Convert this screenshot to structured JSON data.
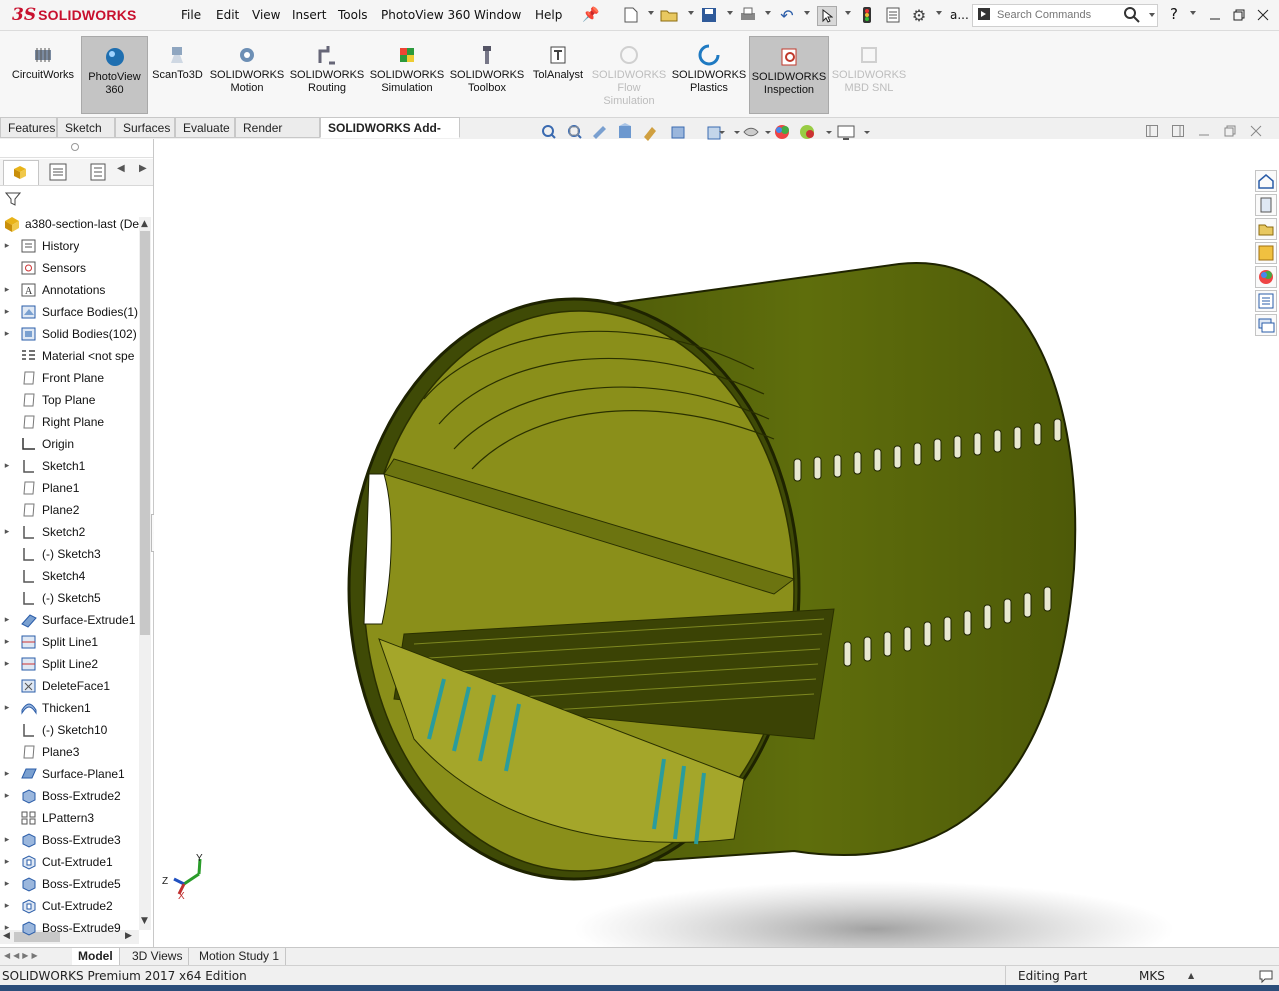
{
  "app": {
    "logo_ds": "3S",
    "logo_text": "SOLIDWORKS"
  },
  "menu": [
    "File",
    "Edit",
    "View",
    "Insert",
    "Tools",
    "PhotoView 360",
    "Window",
    "Help"
  ],
  "quick_access": {
    "overflow": "a...",
    "search_placeholder": "Search Commands",
    "help": "?"
  },
  "command_manager": [
    {
      "label": "CircuitWorks",
      "state": "normal"
    },
    {
      "label": "PhotoView\n360",
      "state": "active"
    },
    {
      "label": "ScanTo3D",
      "state": "normal"
    },
    {
      "label": "SOLIDWORKS\nMotion",
      "state": "normal"
    },
    {
      "label": "SOLIDWORKS\nRouting",
      "state": "normal"
    },
    {
      "label": "SOLIDWORKS\nSimulation",
      "state": "normal"
    },
    {
      "label": "SOLIDWORKS\nToolbox",
      "state": "normal"
    },
    {
      "label": "TolAnalyst",
      "state": "normal"
    },
    {
      "label": "SOLIDWORKS\nFlow\nSimulation",
      "state": "disabled"
    },
    {
      "label": "SOLIDWORKS\nPlastics",
      "state": "normal"
    },
    {
      "label": "SOLIDWORKS\nInspection",
      "state": "active"
    },
    {
      "label": "SOLIDWORKS\nMBD SNL",
      "state": "disabled"
    }
  ],
  "tabs": [
    "Features",
    "Sketch",
    "Surfaces",
    "Evaluate",
    "Render Tools",
    "SOLIDWORKS Add-Ins"
  ],
  "active_tab": "SOLIDWORKS Add-Ins",
  "feature_tree": {
    "root": "a380-section-last (De",
    "items": [
      {
        "label": "History",
        "expandable": true,
        "icon": "history-folder-icon"
      },
      {
        "label": "Sensors",
        "expandable": false,
        "icon": "sensor-icon"
      },
      {
        "label": "Annotations",
        "expandable": true,
        "icon": "annotation-icon"
      },
      {
        "label": "Surface Bodies(1)",
        "expandable": true,
        "icon": "surface-bodies-icon"
      },
      {
        "label": "Solid Bodies(102)",
        "expandable": true,
        "icon": "solid-bodies-icon"
      },
      {
        "label": "Material <not spe",
        "expandable": false,
        "icon": "material-icon"
      },
      {
        "label": "Front Plane",
        "expandable": false,
        "icon": "plane-icon"
      },
      {
        "label": "Top Plane",
        "expandable": false,
        "icon": "plane-icon"
      },
      {
        "label": "Right Plane",
        "expandable": false,
        "icon": "plane-icon"
      },
      {
        "label": "Origin",
        "expandable": false,
        "icon": "origin-icon"
      },
      {
        "label": "Sketch1",
        "expandable": true,
        "icon": "sketch-icon"
      },
      {
        "label": "Plane1",
        "expandable": false,
        "icon": "plane-icon"
      },
      {
        "label": "Plane2",
        "expandable": false,
        "icon": "plane-icon"
      },
      {
        "label": "Sketch2",
        "expandable": true,
        "icon": "sketch-icon"
      },
      {
        "label": "(-) Sketch3",
        "expandable": false,
        "icon": "sketch-icon"
      },
      {
        "label": "Sketch4",
        "expandable": false,
        "icon": "sketch-icon"
      },
      {
        "label": "(-) Sketch5",
        "expandable": false,
        "icon": "sketch-icon"
      },
      {
        "label": "Surface-Extrude1",
        "expandable": true,
        "icon": "surface-extrude-icon"
      },
      {
        "label": "Split Line1",
        "expandable": true,
        "icon": "split-line-icon"
      },
      {
        "label": "Split Line2",
        "expandable": true,
        "icon": "split-line-icon"
      },
      {
        "label": "DeleteFace1",
        "expandable": false,
        "icon": "delete-face-icon"
      },
      {
        "label": "Thicken1",
        "expandable": true,
        "icon": "thicken-icon"
      },
      {
        "label": "(-) Sketch10",
        "expandable": false,
        "icon": "sketch-icon"
      },
      {
        "label": "Plane3",
        "expandable": false,
        "icon": "plane-icon"
      },
      {
        "label": "Surface-Plane1",
        "expandable": true,
        "icon": "surface-plane-icon"
      },
      {
        "label": "Boss-Extrude2",
        "expandable": true,
        "icon": "boss-extrude-icon"
      },
      {
        "label": "LPattern3",
        "expandable": false,
        "icon": "linear-pattern-icon"
      },
      {
        "label": "Boss-Extrude3",
        "expandable": true,
        "icon": "boss-extrude-icon"
      },
      {
        "label": "Cut-Extrude1",
        "expandable": true,
        "icon": "cut-extrude-icon"
      },
      {
        "label": "Boss-Extrude5",
        "expandable": true,
        "icon": "boss-extrude-icon"
      },
      {
        "label": "Cut-Extrude2",
        "expandable": true,
        "icon": "cut-extrude-icon"
      },
      {
        "label": "Boss-Extrude9",
        "expandable": true,
        "icon": "boss-extrude-icon"
      }
    ]
  },
  "triad": {
    "x": "X",
    "y": "Y",
    "z": "Z"
  },
  "bottom_tabs": [
    "Model",
    "3D Views",
    "Motion Study 1"
  ],
  "active_bottom_tab": "Model",
  "status": {
    "edition": "SOLIDWORKS Premium 2017 x64 Edition",
    "mode": "Editing Part",
    "units": "MKS"
  },
  "colors": {
    "model_green": "#5c6b0a",
    "frame_yellow": "#8a8f1a",
    "accent_red": "#c8102e",
    "cyan_part": "#2a9c9c"
  }
}
